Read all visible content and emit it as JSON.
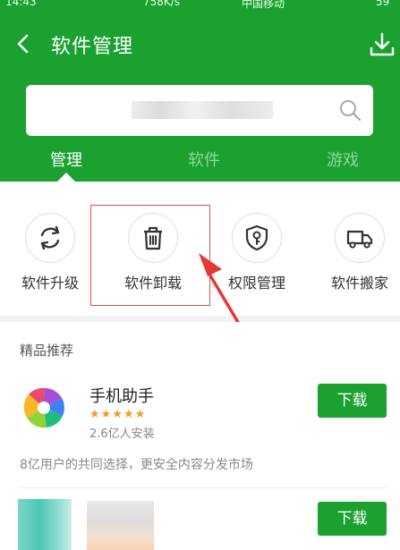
{
  "status_bar": {
    "time": "14:43",
    "network_speed": "758K/s",
    "carrier": "中国移动",
    "battery": "59"
  },
  "header": {
    "title": "软件管理",
    "back_icon": "chevron-left-icon",
    "download_icon": "download-tray-icon"
  },
  "search": {
    "icon": "search-icon"
  },
  "tabs": [
    {
      "label": "管理",
      "active": true
    },
    {
      "label": "软件",
      "active": false
    },
    {
      "label": "游戏",
      "active": false
    }
  ],
  "tools": [
    {
      "label": "软件升级",
      "icon": "refresh-icon"
    },
    {
      "label": "软件卸载",
      "icon": "trash-icon"
    },
    {
      "label": "权限管理",
      "icon": "shield-key-icon"
    },
    {
      "label": "软件搬家",
      "icon": "moving-truck-icon"
    }
  ],
  "recommend": {
    "section_title": "精品推荐",
    "apps": [
      {
        "name": "手机助手",
        "rating": 5,
        "rating_text": "★★★★★",
        "installs": "2.6亿人安装",
        "description": "8亿用户的共同选择，更安全内容分发市场",
        "button": "下载"
      },
      {
        "button": "下载"
      }
    ]
  },
  "colors": {
    "brand_green": "#1aa130",
    "annotation_red": "#d9534f",
    "star_orange": "#f59a23"
  }
}
